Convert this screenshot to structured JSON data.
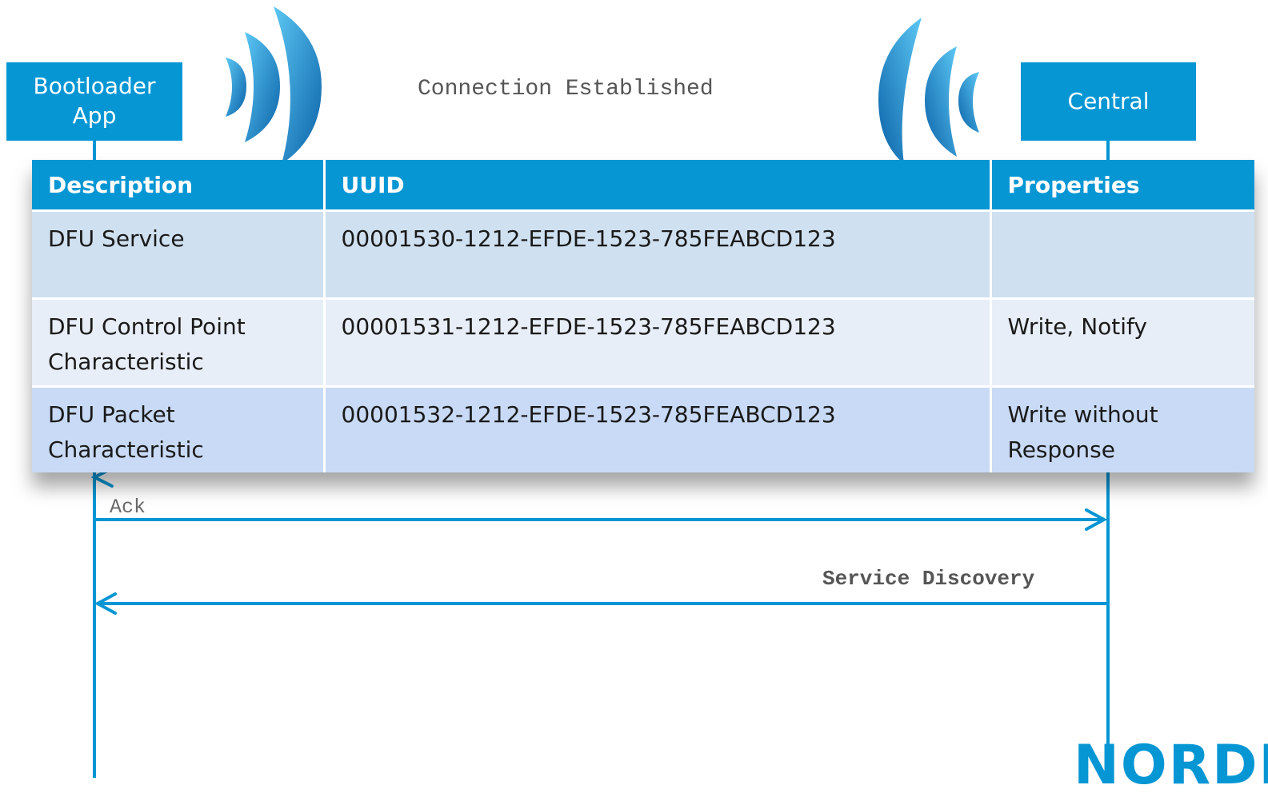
{
  "participants": {
    "left": "Bootloader\nApp",
    "right": "Central"
  },
  "messages": {
    "connection": "Connection Established",
    "ack": "Ack",
    "discovery": "Service Discovery"
  },
  "table": {
    "headers": [
      "Description",
      "UUID",
      "Properties"
    ],
    "rows": [
      [
        "DFU Service",
        "00001530-1212-EFDE-1523-785FEABCD123",
        ""
      ],
      [
        "DFU Control Point Characteristic",
        "00001531-1212-EFDE-1523-785FEABCD123",
        "Write, Notify"
      ],
      [
        "DFU Packet Characteristic",
        "00001532-1212-EFDE-1523-785FEABCD123",
        "Write without Response"
      ]
    ]
  },
  "logo": "NORDIC",
  "colors": {
    "accent": "#0796d4",
    "row1": "#cfe0f0",
    "row2": "#e7eef8",
    "row3": "#c8daf5"
  },
  "icons": {
    "left_signal": "wireless-signal-icon",
    "right_signal": "wireless-signal-icon"
  }
}
